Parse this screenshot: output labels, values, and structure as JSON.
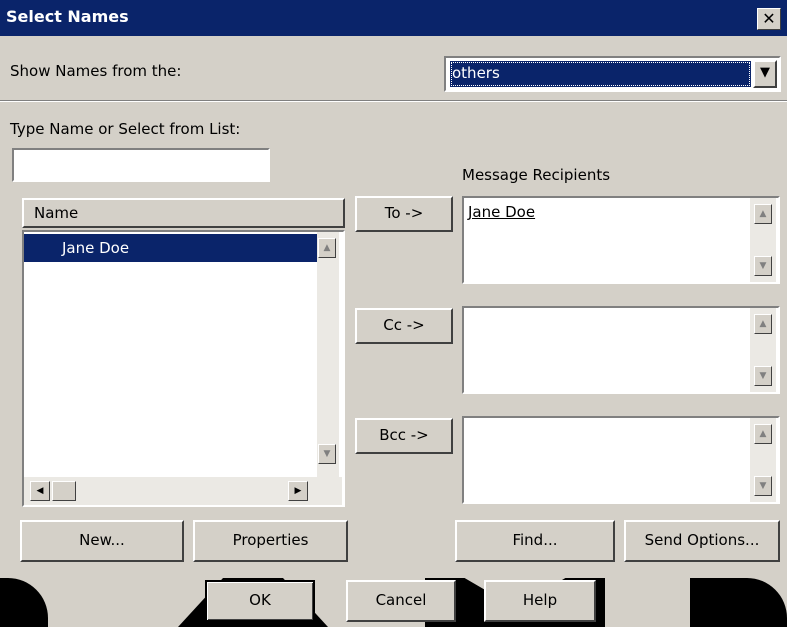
{
  "window": {
    "title": "Select Names",
    "close_label": "✕"
  },
  "show_names": {
    "label": "Show Names from the:",
    "selected": "others"
  },
  "type_name": {
    "label": "Type Name or Select from List:",
    "value": ""
  },
  "names_list": {
    "header": "Name",
    "items": [
      "Jane Doe"
    ]
  },
  "recipients": {
    "label": "Message Recipients",
    "to_button": "To ->",
    "cc_button": "Cc ->",
    "bcc_button": "Bcc ->",
    "to": [
      "Jane Doe"
    ],
    "cc": [],
    "bcc": []
  },
  "buttons": {
    "new": "New...",
    "properties": "Properties",
    "find": "Find...",
    "send_options": "Send Options...",
    "ok": "OK",
    "cancel": "Cancel",
    "help": "Help"
  },
  "icons": {
    "dropdown": "chevron-down-icon",
    "scroll_up": "arrow-up-icon",
    "scroll_down": "arrow-down-icon",
    "scroll_left": "arrow-left-icon",
    "scroll_right": "arrow-right-icon"
  },
  "colors": {
    "titlebar": "#0a246a",
    "face": "#d4d0c8",
    "selection": "#0a246a"
  }
}
